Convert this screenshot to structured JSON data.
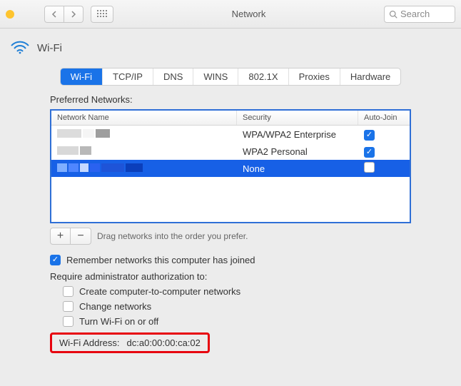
{
  "window": {
    "title": "Network"
  },
  "toolbar": {
    "search_placeholder": "Search"
  },
  "sheet": {
    "title": "Wi-Fi"
  },
  "tabs": [
    "Wi-Fi",
    "TCP/IP",
    "DNS",
    "WINS",
    "802.1X",
    "Proxies",
    "Hardware"
  ],
  "activeTab": 0,
  "section": {
    "preferred_label": "Preferred Networks:",
    "columns": {
      "name": "Network Name",
      "security": "Security",
      "autojoin": "Auto-Join"
    },
    "rows": [
      {
        "security": "WPA/WPA2 Enterprise",
        "autojoin": true,
        "selected": false
      },
      {
        "security": "WPA2 Personal",
        "autojoin": true,
        "selected": false
      },
      {
        "security": "None",
        "autojoin": false,
        "selected": true
      }
    ],
    "drag_hint": "Drag networks into the order you prefer."
  },
  "options": {
    "remember_label": "Remember networks this computer has joined",
    "remember_checked": true,
    "admin_heading": "Require administrator authorization to:",
    "admin_items": [
      {
        "label": "Create computer-to-computer networks",
        "checked": false
      },
      {
        "label": "Change networks",
        "checked": false
      },
      {
        "label": "Turn Wi-Fi on or off",
        "checked": false
      }
    ]
  },
  "address": {
    "label": "Wi-Fi Address:",
    "value": "dc:a0:00:00:ca:02"
  }
}
